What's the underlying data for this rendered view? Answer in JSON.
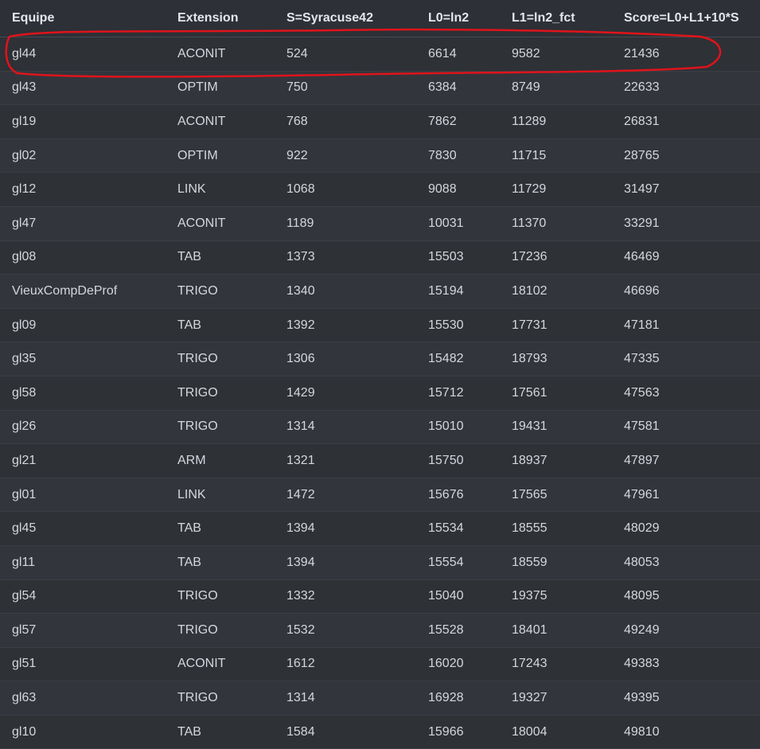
{
  "table": {
    "columns": [
      "Equipe",
      "Extension",
      "S=Syracuse42",
      "L0=ln2",
      "L1=ln2_fct",
      "Score=L0+L1+10*S"
    ],
    "rows": [
      [
        "gl44",
        "ACONIT",
        "524",
        "6614",
        "9582",
        "21436"
      ],
      [
        "gl43",
        "OPTIM",
        "750",
        "6384",
        "8749",
        "22633"
      ],
      [
        "gl19",
        "ACONIT",
        "768",
        "7862",
        "11289",
        "26831"
      ],
      [
        "gl02",
        "OPTIM",
        "922",
        "7830",
        "11715",
        "28765"
      ],
      [
        "gl12",
        "LINK",
        "1068",
        "9088",
        "11729",
        "31497"
      ],
      [
        "gl47",
        "ACONIT",
        "1189",
        "10031",
        "11370",
        "33291"
      ],
      [
        "gl08",
        "TAB",
        "1373",
        "15503",
        "17236",
        "46469"
      ],
      [
        "VieuxCompDeProf",
        "TRIGO",
        "1340",
        "15194",
        "18102",
        "46696"
      ],
      [
        "gl09",
        "TAB",
        "1392",
        "15530",
        "17731",
        "47181"
      ],
      [
        "gl35",
        "TRIGO",
        "1306",
        "15482",
        "18793",
        "47335"
      ],
      [
        "gl58",
        "TRIGO",
        "1429",
        "15712",
        "17561",
        "47563"
      ],
      [
        "gl26",
        "TRIGO",
        "1314",
        "15010",
        "19431",
        "47581"
      ],
      [
        "gl21",
        "ARM",
        "1321",
        "15750",
        "18937",
        "47897"
      ],
      [
        "gl01",
        "LINK",
        "1472",
        "15676",
        "17565",
        "47961"
      ],
      [
        "gl45",
        "TAB",
        "1394",
        "15534",
        "18555",
        "48029"
      ],
      [
        "gl11",
        "TAB",
        "1394",
        "15554",
        "18559",
        "48053"
      ],
      [
        "gl54",
        "TRIGO",
        "1332",
        "15040",
        "19375",
        "48095"
      ],
      [
        "gl57",
        "TRIGO",
        "1532",
        "15528",
        "18401",
        "49249"
      ],
      [
        "gl51",
        "ACONIT",
        "1612",
        "16020",
        "17243",
        "49383"
      ],
      [
        "gl63",
        "TRIGO",
        "1314",
        "16928",
        "19327",
        "49395"
      ],
      [
        "gl10",
        "TAB",
        "1584",
        "15966",
        "18004",
        "49810"
      ]
    ]
  },
  "colors": {
    "background": "#2b2e33",
    "text": "#d4d7dc",
    "annotation": "#e0131b"
  }
}
